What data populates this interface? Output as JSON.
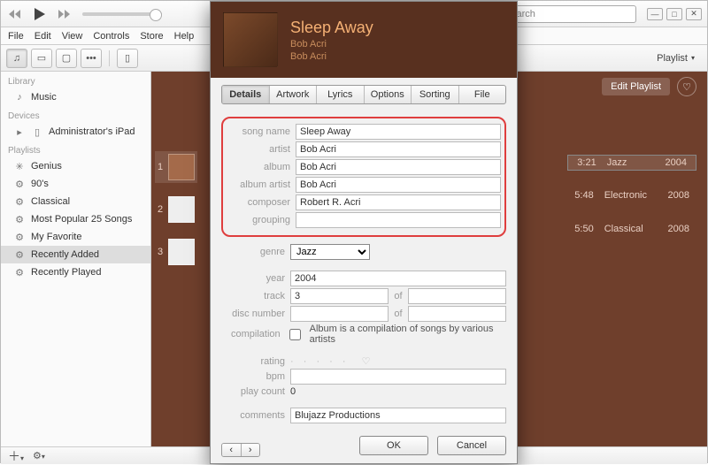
{
  "menubar": [
    "File",
    "Edit",
    "View",
    "Controls",
    "Store",
    "Help"
  ],
  "search": {
    "placeholder": "Search"
  },
  "view_dropdown": "Playlist",
  "sidebar": {
    "sections": [
      {
        "head": "Library",
        "items": [
          {
            "icon": "music",
            "label": "Music"
          }
        ]
      },
      {
        "head": "Devices",
        "items": [
          {
            "icon": "ipad",
            "label": "Administrator's iPad"
          }
        ]
      },
      {
        "head": "Playlists",
        "items": [
          {
            "icon": "genius",
            "label": "Genius"
          },
          {
            "icon": "gear",
            "label": "90's"
          },
          {
            "icon": "gear",
            "label": "Classical"
          },
          {
            "icon": "gear",
            "label": "Most Popular 25 Songs"
          },
          {
            "icon": "gear",
            "label": "My Favorite"
          },
          {
            "icon": "gear",
            "label": "Recently Added",
            "selected": true
          },
          {
            "icon": "gear",
            "label": "Recently Played"
          }
        ]
      }
    ]
  },
  "content": {
    "edit_btn": "Edit Playlist",
    "rows": [
      {
        "n": "1",
        "dur": "3:21",
        "genre": "Jazz",
        "year": "2004",
        "selected": true
      },
      {
        "n": "2",
        "dur": "5:48",
        "genre": "Electronic",
        "year": "2008"
      },
      {
        "n": "3",
        "dur": "5:50",
        "genre": "Classical",
        "year": "2008"
      }
    ]
  },
  "modal": {
    "title": "Sleep Away",
    "artist_line": "Bob Acri",
    "album_line": "Bob Acri",
    "tabs": [
      "Details",
      "Artwork",
      "Lyrics",
      "Options",
      "Sorting",
      "File"
    ],
    "active_tab": 0,
    "fields": {
      "song_name": {
        "label": "song name",
        "value": "Sleep Away"
      },
      "artist": {
        "label": "artist",
        "value": "Bob Acri"
      },
      "album": {
        "label": "album",
        "value": "Bob Acri"
      },
      "album_artist": {
        "label": "album artist",
        "value": "Bob Acri"
      },
      "composer": {
        "label": "composer",
        "value": "Robert R. Acri"
      },
      "grouping": {
        "label": "grouping",
        "value": ""
      },
      "genre": {
        "label": "genre",
        "value": "Jazz"
      },
      "year": {
        "label": "year",
        "value": "2004"
      },
      "track": {
        "label": "track",
        "value": "3",
        "of_label": "of",
        "total": ""
      },
      "disc": {
        "label": "disc number",
        "value": "",
        "of_label": "of",
        "total": ""
      },
      "compilation": {
        "label": "compilation",
        "text": "Album is a compilation of songs by various artists"
      },
      "rating": {
        "label": "rating"
      },
      "bpm": {
        "label": "bpm",
        "value": ""
      },
      "play_count": {
        "label": "play count",
        "value": "0"
      },
      "comments": {
        "label": "comments",
        "value": "Blujazz Productions"
      }
    },
    "ok": "OK",
    "cancel": "Cancel"
  }
}
